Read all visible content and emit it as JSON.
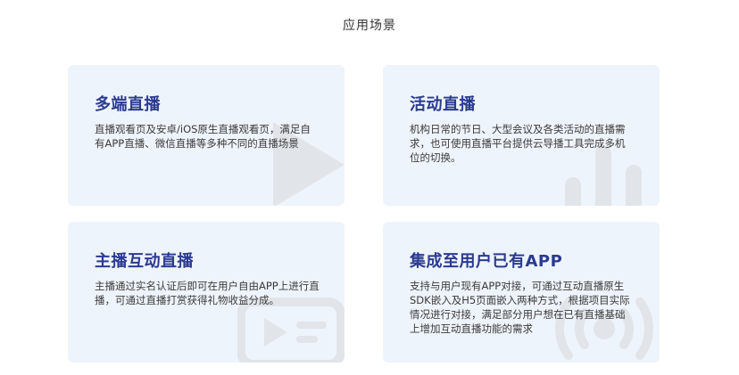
{
  "section": {
    "title": "应用场景"
  },
  "cards": [
    {
      "title": "多端直播",
      "desc": "直播观看页及安卓/iOS原生直播观看页，满足自有APP直播、微信直播等多种不同的直播场景",
      "icon": "play-icon"
    },
    {
      "title": "活动直播",
      "desc": "机构日常的节日、大型会议及各类活动的直播需求，也可使用直播平台提供云导播工具完成多机位的切换。",
      "icon": "bar-chart-icon"
    },
    {
      "title": "主播互动直播",
      "desc": "主播通过实名认证后即可在用户自由APP上进行直播，可通过直播打赏获得礼物收益分成。",
      "icon": "live-screen-icon"
    },
    {
      "title": "集成至用户已有APP",
      "desc": "支持与用户现有APP对接，可通过互动直播原生SDK嵌入及H5页面嵌入两种方式，根据项目实际情况进行对接，满足部分用户想在已有直播基础上增加互动直播功能的需求",
      "icon": "broadcast-icon"
    }
  ],
  "colors": {
    "card_bg": "#eef4fb",
    "title": "#2b3a8f",
    "icon": "#dde3ea"
  }
}
